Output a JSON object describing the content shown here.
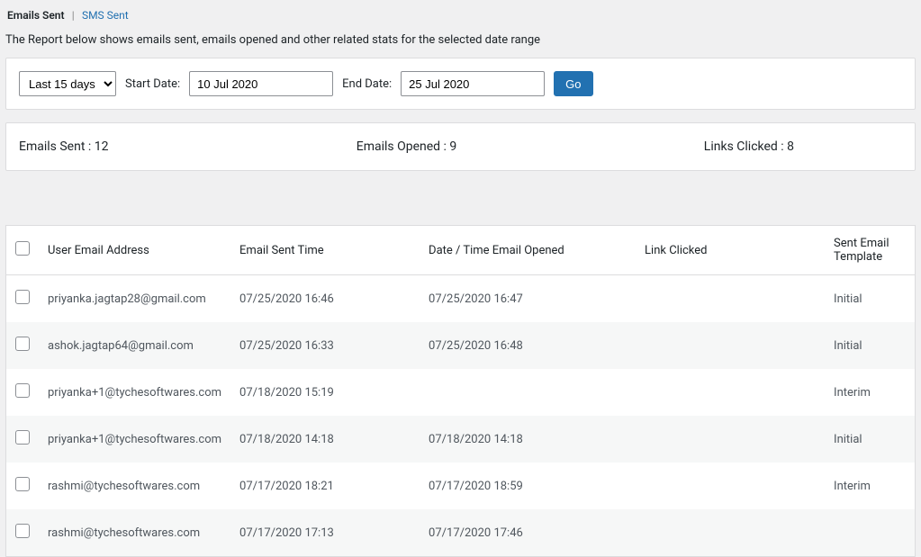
{
  "tabs": {
    "emails_sent": "Emails Sent",
    "sms_sent": "SMS Sent"
  },
  "subtitle": "The Report below shows emails sent, emails opened and other related stats for the selected date range",
  "filters": {
    "range": "Last 15 days",
    "start_label": "Start Date:",
    "start_value": "10 Jul 2020",
    "end_label": "End Date:",
    "end_value": "25 Jul 2020",
    "go": "Go"
  },
  "stats": {
    "sent": "Emails Sent : 12",
    "opened": "Emails Opened : 9",
    "clicked": "Links Clicked : 8"
  },
  "table": {
    "headers": {
      "email": "User Email Address",
      "sent_time": "Email Sent Time",
      "opened_time": "Date / Time Email Opened",
      "link_clicked": "Link Clicked",
      "template": "Sent Email Template"
    },
    "rows": [
      {
        "email": "priyanka.jagtap28@gmail.com",
        "sent": "07/25/2020 16:46",
        "opened": "07/25/2020 16:47",
        "link": "",
        "tpl": "Initial"
      },
      {
        "email": "ashok.jagtap64@gmail.com",
        "sent": "07/25/2020 16:33",
        "opened": "07/25/2020 16:48",
        "link": "",
        "tpl": "Initial"
      },
      {
        "email": "priyanka+1@tychesoftwares.com",
        "sent": "07/18/2020 15:19",
        "opened": "",
        "link": "",
        "tpl": "Interim"
      },
      {
        "email": "priyanka+1@tychesoftwares.com",
        "sent": "07/18/2020 14:18",
        "opened": "07/18/2020 14:18",
        "link": "",
        "tpl": "Initial"
      },
      {
        "email": "rashmi@tychesoftwares.com",
        "sent": "07/17/2020 18:21",
        "opened": "07/17/2020 18:59",
        "link": "",
        "tpl": "Interim"
      },
      {
        "email": "rashmi@tychesoftwares.com",
        "sent": "07/17/2020 17:13",
        "opened": "07/17/2020 17:46",
        "link": "",
        "tpl": ""
      }
    ]
  }
}
